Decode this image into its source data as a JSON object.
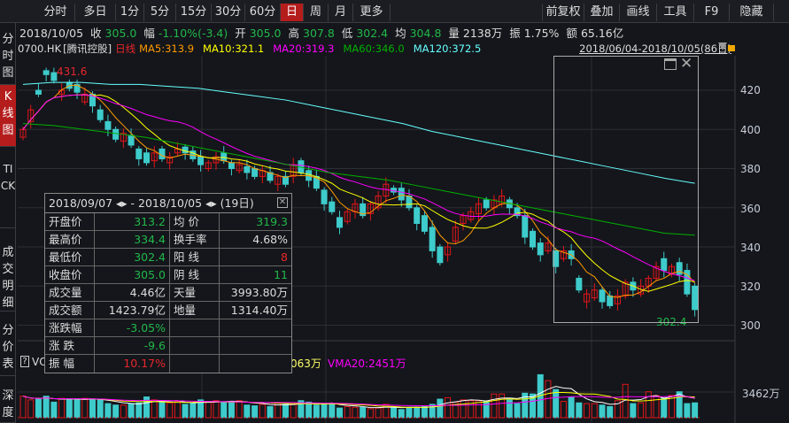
{
  "toolbar": {
    "left": [
      "分时",
      "多日",
      "1分",
      "5分",
      "15分",
      "30分",
      "60分",
      "日",
      "周",
      "月",
      "更多"
    ],
    "active_index": 7,
    "right": [
      "前复权",
      "叠加",
      "画线",
      "工具",
      "F9",
      "隐藏"
    ]
  },
  "sidebar": {
    "tabs": [
      "分时图",
      "K线图",
      "TICK",
      "成交明细",
      "分价表",
      "深度"
    ],
    "active_index": 1
  },
  "info": {
    "date": "2018/10/05",
    "close_label": "收",
    "close": "305.0",
    "chg_label": "幅",
    "chg": "-1.10%(-3.4)",
    "open_label": "开",
    "open": "305.0",
    "high_label": "高",
    "high": "307.8",
    "low_label": "低",
    "low": "302.4",
    "avg_label": "均",
    "avg": "304.8",
    "vol_label": "量",
    "vol": "2138万",
    "amp_label": "振",
    "amp": "1.75%",
    "amt_label": "额",
    "amt": "65.16亿"
  },
  "ma_line": {
    "code": "0700.HK",
    "name": "[腾讯控股]",
    "period": "日线",
    "ma5": "MA5:313.9",
    "ma10": "MA10:321.1",
    "ma20": "MA20:319.3",
    "ma60": "MA60:346.0",
    "ma120": "MA120:372.5",
    "range": "2018/06/04-2018/10/05(86日)"
  },
  "colors": {
    "up": "#e0161b",
    "down": "#3ecbcb",
    "ma5": "#ff9a00",
    "ma10": "#ffff00",
    "ma20": "#ff00ff",
    "ma60": "#00b000",
    "ma120": "#66ffff"
  },
  "annotations": {
    "max": "431.6",
    "min": "302.4"
  },
  "vol_line": {
    "label": "VC",
    "vma_partial": "063万",
    "vma20": "VMA20:2451万",
    "ref": "3462万"
  },
  "stats": {
    "header": "2018/09/07 ◂▸ - 2018/10/05 ◂▸   (19日)",
    "rows": [
      [
        "开盘价",
        "313.2",
        "均  价",
        "319.3"
      ],
      [
        "最高价",
        "334.4",
        "换手率",
        "4.68%"
      ],
      [
        "最低价",
        "302.4",
        "阳  线",
        "8"
      ],
      [
        "收盘价",
        "305.0",
        "阴  线",
        "11"
      ],
      [
        "成交量",
        "4.46亿",
        "天量",
        "3993.80万"
      ],
      [
        "成交额",
        "1423.79亿",
        "地量",
        "1314.40万"
      ],
      [
        "涨跌幅",
        "-3.05%",
        "",
        ""
      ],
      [
        "涨  跌",
        "-9.6",
        "",
        ""
      ],
      [
        "振  幅",
        "10.17%",
        "",
        ""
      ]
    ]
  },
  "chart_data": {
    "type": "candlestick",
    "yticks": [
      300,
      320,
      340,
      360,
      380,
      400,
      420
    ],
    "ylim": [
      298,
      436
    ],
    "close": [
      400,
      410,
      418,
      428,
      425,
      420,
      421,
      419,
      418,
      412,
      405,
      400,
      395,
      398,
      392,
      385,
      383,
      388,
      385,
      386,
      390,
      388,
      385,
      382,
      383,
      386,
      384,
      380,
      382,
      378,
      376,
      379,
      374,
      376,
      372,
      382,
      378,
      374,
      370,
      362,
      358,
      350,
      358,
      362,
      356,
      362,
      366,
      372,
      368,
      364,
      360,
      352,
      348,
      338,
      332,
      340,
      350,
      356,
      358,
      362,
      360,
      364,
      366,
      360,
      356,
      345,
      340,
      336,
      342,
      330,
      338,
      334,
      318,
      316,
      318,
      312,
      310,
      315,
      322,
      318,
      320,
      324,
      330,
      328,
      330,
      326,
      316,
      308
    ],
    "open": [
      396,
      404,
      420,
      430,
      429,
      418,
      424,
      423,
      414,
      418,
      410,
      404,
      400,
      394,
      397,
      390,
      388,
      384,
      390,
      383,
      388,
      391,
      389,
      386,
      380,
      383,
      388,
      383,
      379,
      381,
      380,
      376,
      378,
      372,
      376,
      376,
      384,
      379,
      376,
      369,
      363,
      355,
      353,
      358,
      362,
      357,
      360,
      366,
      370,
      370,
      366,
      360,
      356,
      350,
      340,
      336,
      343,
      352,
      354,
      357,
      364,
      360,
      362,
      364,
      360,
      356,
      348,
      342,
      338,
      338,
      334,
      338,
      324,
      312,
      314,
      318,
      315,
      311,
      315,
      322,
      316,
      320,
      324,
      334,
      326,
      332,
      328,
      320,
      315
    ],
    "ma60": [
      403,
      402,
      400,
      398,
      396,
      393,
      390,
      387,
      384,
      381,
      378,
      376,
      374,
      371,
      368,
      365,
      362,
      359,
      356,
      353,
      350,
      347,
      346
    ],
    "ma120": [
      423,
      424,
      424,
      423,
      423,
      422,
      421,
      419,
      417,
      415,
      412,
      409,
      406,
      403,
      399,
      396,
      393,
      390,
      387,
      384,
      381,
      378,
      375,
      372.5
    ],
    "volume": [
      2900,
      2400,
      2500,
      2900,
      2100,
      2600,
      2500,
      2500,
      2600,
      2400,
      2400,
      1900,
      1700,
      1700,
      1900,
      2000,
      2800,
      2400,
      2100,
      2000,
      2200,
      1800,
      1900,
      2400,
      2100,
      2300,
      2100,
      2200,
      2300,
      1700,
      1600,
      1800,
      1500,
      2000,
      1800,
      1800,
      2300,
      2100,
      1700,
      1900,
      1900,
      1300,
      1500,
      1400,
      1400,
      1200,
      1300,
      1800,
      1400,
      1100,
      1400,
      1400,
      1600,
      1800,
      2500,
      2700,
      2100,
      2400,
      2300,
      2300,
      2200,
      3200,
      3200,
      2400,
      1900,
      3300,
      3200,
      5800,
      5000,
      3800,
      2200,
      2800,
      2000,
      1900,
      1900,
      1700,
      1500,
      2300,
      4500,
      1900,
      2000,
      3500,
      3000,
      2700,
      3000,
      3500,
      1900,
      2000,
      2000
    ],
    "volume_ref": 3462
  }
}
